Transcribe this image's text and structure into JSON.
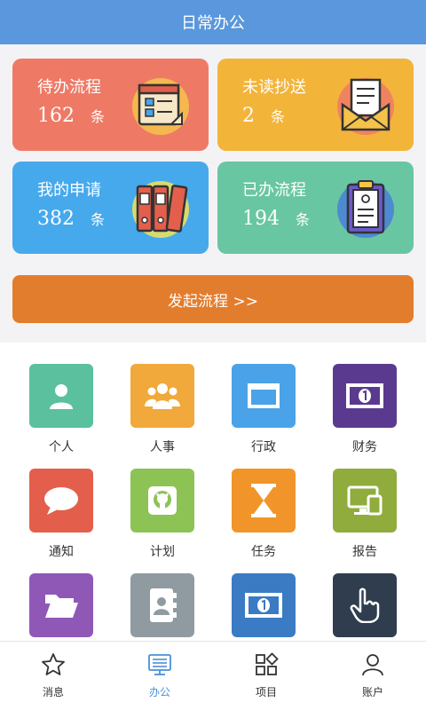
{
  "header": {
    "title": "日常办公"
  },
  "cards": {
    "todo": {
      "title": "待办流程",
      "count": "162",
      "unit": "条"
    },
    "unread": {
      "title": "未读抄送",
      "count": "2",
      "unit": "条"
    },
    "mine": {
      "title": "我的申请",
      "count": "382",
      "unit": "条"
    },
    "done": {
      "title": "已办流程",
      "count": "194",
      "unit": "条"
    }
  },
  "start_button": {
    "label": "发起流程 >>"
  },
  "modules": [
    {
      "label": "个人",
      "icon": "person-icon",
      "color": "#5bc09d"
    },
    {
      "label": "人事",
      "icon": "group-icon",
      "color": "#f0a93a"
    },
    {
      "label": "行政",
      "icon": "window-icon",
      "color": "#4aa3e8"
    },
    {
      "label": "财务",
      "icon": "banknote-icon",
      "color": "#5a3a8e"
    },
    {
      "label": "通知",
      "icon": "chat-bubble-icon",
      "color": "#e35f4c"
    },
    {
      "label": "计划",
      "icon": "github-icon",
      "color": "#8dc255"
    },
    {
      "label": "任务",
      "icon": "hourglass-icon",
      "color": "#f1952a"
    },
    {
      "label": "报告",
      "icon": "devices-icon",
      "color": "#8fac3d"
    },
    {
      "label": "",
      "icon": "folder-icon",
      "color": "#8f58b6"
    },
    {
      "label": "",
      "icon": "contacts-icon",
      "color": "#8f9ba0"
    },
    {
      "label": "",
      "icon": "banknote-icon",
      "color": "#3a7bc4"
    },
    {
      "label": "",
      "icon": "pointer-hand-icon",
      "color": "#2f3d4f"
    }
  ],
  "tabs": [
    {
      "label": "消息",
      "icon": "star-icon",
      "active": false
    },
    {
      "label": "办公",
      "icon": "monitor-icon",
      "active": true
    },
    {
      "label": "项目",
      "icon": "grid-icon",
      "active": false
    },
    {
      "label": "账户",
      "icon": "user-icon",
      "active": false
    }
  ],
  "colors": {
    "accent": "#5a97dc",
    "active_tab": "#4a90d9",
    "start_button": "#e37d2e"
  }
}
